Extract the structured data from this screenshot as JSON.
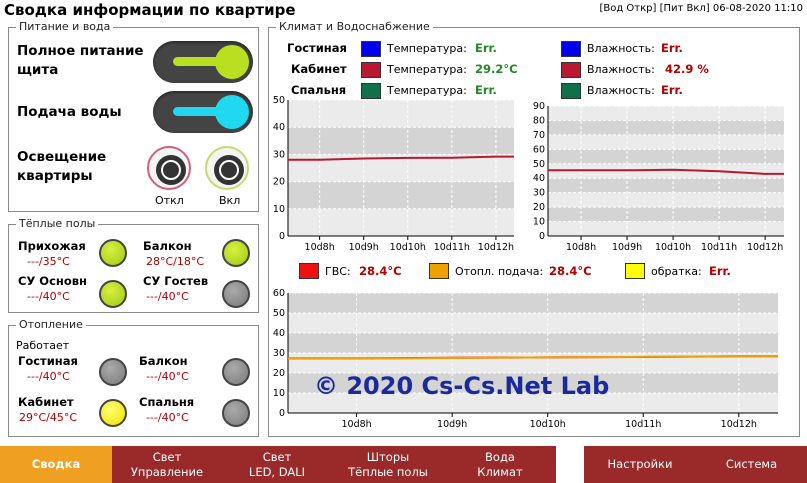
{
  "title": "Сводка информации по квартире",
  "status": "[Вод Откр]  [Пит Вкл] 06-08-2020 11:10",
  "colors": {
    "accent_lime": "#b8e020",
    "accent_cyan": "#20d8f0",
    "nav_red": "#9a2a2a",
    "nav_active": "#f0a020",
    "err_red": "#b00000",
    "ok_green": "#228822",
    "watermark_blue": "#1a2a9c"
  },
  "power_water": {
    "legend": "Питание и вода",
    "power_label": "Полное питание щита",
    "water_label": "Подача воды",
    "light_label": "Освещение квартиры",
    "off_label": "Откл",
    "on_label": "Вкл"
  },
  "floors": {
    "legend": "Тёплые полы",
    "rooms": [
      {
        "name": "Прихожая",
        "temps": "---/35°C",
        "state": "lime"
      },
      {
        "name": "Балкон",
        "temps": "28°C/18°C",
        "state": "lime"
      },
      {
        "name": "СУ Основн",
        "temps": "---/40°C",
        "state": "lime"
      },
      {
        "name": "СУ Гостев",
        "temps": "---/40°C",
        "state": "grey"
      }
    ]
  },
  "heating": {
    "legend": "Отопление",
    "status": "Работает",
    "rooms": [
      {
        "name": "Гостиная",
        "temps": "---/40°C",
        "state": "grey"
      },
      {
        "name": "Балкон",
        "temps": "---/40°C",
        "state": "grey"
      },
      {
        "name": "Кабинет",
        "temps": "29°C/45°C",
        "state": "yellow"
      },
      {
        "name": "Спальня",
        "temps": "---/40°C",
        "state": "grey"
      }
    ]
  },
  "climate": {
    "legend": "Климат и Водоснабжение",
    "temp_label": "Температура:",
    "hum_label": "Влажность:",
    "rows": [
      {
        "room": "Гостиная",
        "temp_color": "#0000ee",
        "temp": "Err.",
        "hum_color": "#0000ee",
        "hum": "Err."
      },
      {
        "room": "Кабинет",
        "temp_color": "#b81830",
        "temp": "29.2°C",
        "hum_color": "#b81830",
        "hum": "42.9 %"
      },
      {
        "room": "Спальня",
        "temp_color": "#10704a",
        "temp": "Err.",
        "hum_color": "#10704a",
        "hum": "Err."
      }
    ],
    "water": [
      {
        "label": "ГВС:",
        "color": "#ee1111",
        "value": "28.4°C"
      },
      {
        "label": "Отопл. подача:",
        "color": "#f0a000",
        "value": "28.4°C"
      },
      {
        "label": "обратка:",
        "color": "#ffff00",
        "value": "Err."
      }
    ]
  },
  "chart_data": [
    {
      "type": "line",
      "x": [
        "10d8h",
        "10d9h",
        "10d10h",
        "10d11h",
        "10d12h"
      ],
      "ylim": [
        0,
        50
      ],
      "yticks": [
        0,
        10,
        20,
        30,
        40,
        50
      ],
      "grid": true,
      "series": [
        {
          "color": "#b81830",
          "values": [
            28,
            28.5,
            28.7,
            28.8,
            29.2
          ]
        }
      ]
    },
    {
      "type": "line",
      "x": [
        "10d8h",
        "10d9h",
        "10d10h",
        "10d11h",
        "10d12h"
      ],
      "ylim": [
        0,
        90
      ],
      "yticks": [
        0,
        10,
        20,
        30,
        40,
        50,
        60,
        70,
        80,
        90
      ],
      "grid": true,
      "series": [
        {
          "color": "#b81830",
          "values": [
            45.5,
            45.5,
            45.8,
            44.8,
            43
          ]
        }
      ]
    },
    {
      "type": "line",
      "x": [
        "10d8h",
        "10d9h",
        "10d10h",
        "10d11h",
        "10d12h"
      ],
      "ylim": [
        0,
        60
      ],
      "yticks": [
        0,
        10,
        20,
        30,
        40,
        50,
        60
      ],
      "grid": true,
      "series": [
        {
          "color": "#ee1111",
          "values": [
            27.3,
            27.6,
            27.8,
            28.0,
            28.4
          ]
        },
        {
          "color": "#f0a000",
          "values": [
            27.2,
            27.5,
            27.8,
            28.1,
            28.4
          ]
        }
      ]
    }
  ],
  "watermark": "© 2020 Cs-Cs.Net Lab",
  "nav": [
    {
      "label": "Сводка",
      "active": true
    },
    {
      "label": "Свет\nУправление"
    },
    {
      "label": "Свет\nLED, DALI"
    },
    {
      "label": "Шторы\nТёплые полы"
    },
    {
      "label": "Вода\nКлимат"
    },
    {
      "label": "Настройки"
    },
    {
      "label": "Система"
    }
  ]
}
